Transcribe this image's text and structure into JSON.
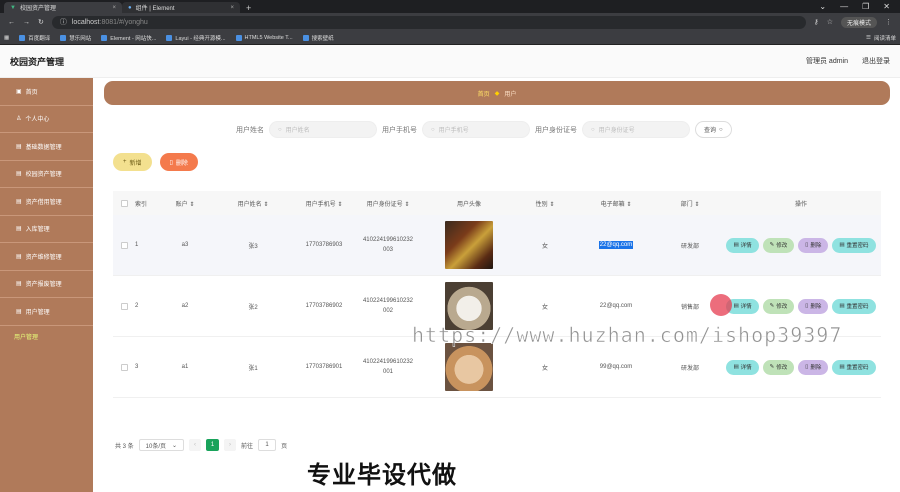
{
  "browser": {
    "tabs": [
      {
        "title": "校园资产管理",
        "icon": "vue-icon"
      },
      {
        "title": "组件 | Element",
        "icon": "globe-icon"
      }
    ],
    "url_host": "localhost",
    "url_path": ":8081/#/yonghu",
    "profile_label": "无痕模式",
    "bookmarks": [
      "百度翻译",
      "慧乐网站",
      "Element - 网站快...",
      "Layui - 经典开源模...",
      "HTML5 Website T...",
      "搜索壁纸"
    ],
    "reading_list": "阅读清单"
  },
  "header": {
    "title": "校园资产管理",
    "user": "管理员 admin",
    "logout": "退出登录"
  },
  "sidebar": {
    "items": [
      "首页",
      "个人中心",
      "基础数据管理",
      "校园资产管理",
      "资产借用管理",
      "入库管理",
      "资产维修管理",
      "资产报废管理",
      "用户管理"
    ],
    "sub_items": [
      "用户管理"
    ]
  },
  "breadcrumb": {
    "home": "首页",
    "current": "用户"
  },
  "search": {
    "name_label": "用户姓名",
    "name_placeholder": "用户姓名",
    "phone_label": "用户手机号",
    "phone_placeholder": "用户手机号",
    "id_label": "用户身份证号",
    "id_placeholder": "用户身份证号",
    "query": "查询"
  },
  "toolbar": {
    "add": "新增",
    "delete": "删除"
  },
  "table": {
    "headers": [
      "索引",
      "账户",
      "用户姓名",
      "用户手机号",
      "用户身份证号",
      "用户头像",
      "性别",
      "电子邮箱",
      "部门",
      "操作"
    ],
    "rows": [
      {
        "index": "1",
        "account": "a3",
        "name": "张3",
        "phone": "17703786903",
        "idcard": "410224199610232\n003",
        "gender": "女",
        "email": "22@qq.com",
        "dept": "研发部"
      },
      {
        "index": "2",
        "account": "a2",
        "name": "张2",
        "phone": "17703786902",
        "idcard": "410224199610232\n002",
        "gender": "女",
        "email": "22@qq.com",
        "dept": "销售部"
      },
      {
        "index": "3",
        "account": "a1",
        "name": "张1",
        "phone": "17703786901",
        "idcard": "410224199610232\n001",
        "gender": "女",
        "email": "99@qq.com",
        "dept": "研发部"
      }
    ],
    "ops": {
      "view": "详情",
      "edit": "修改",
      "del": "删除",
      "reset": "重置密码"
    }
  },
  "pager": {
    "total": "共 3 条",
    "size": "10条/页",
    "page": "1",
    "goto": "前往",
    "goto_value": "1",
    "page_unit": "页"
  },
  "overlay": {
    "watermark": "https://www.huzhan.com/ishop39397",
    "banner": "专业毕设代做"
  },
  "colors": {
    "sidebar": "#b07a5a",
    "accent_green": "#19a35b",
    "delete_btn": "#f47a4c",
    "add_btn": "#f3e08f"
  }
}
